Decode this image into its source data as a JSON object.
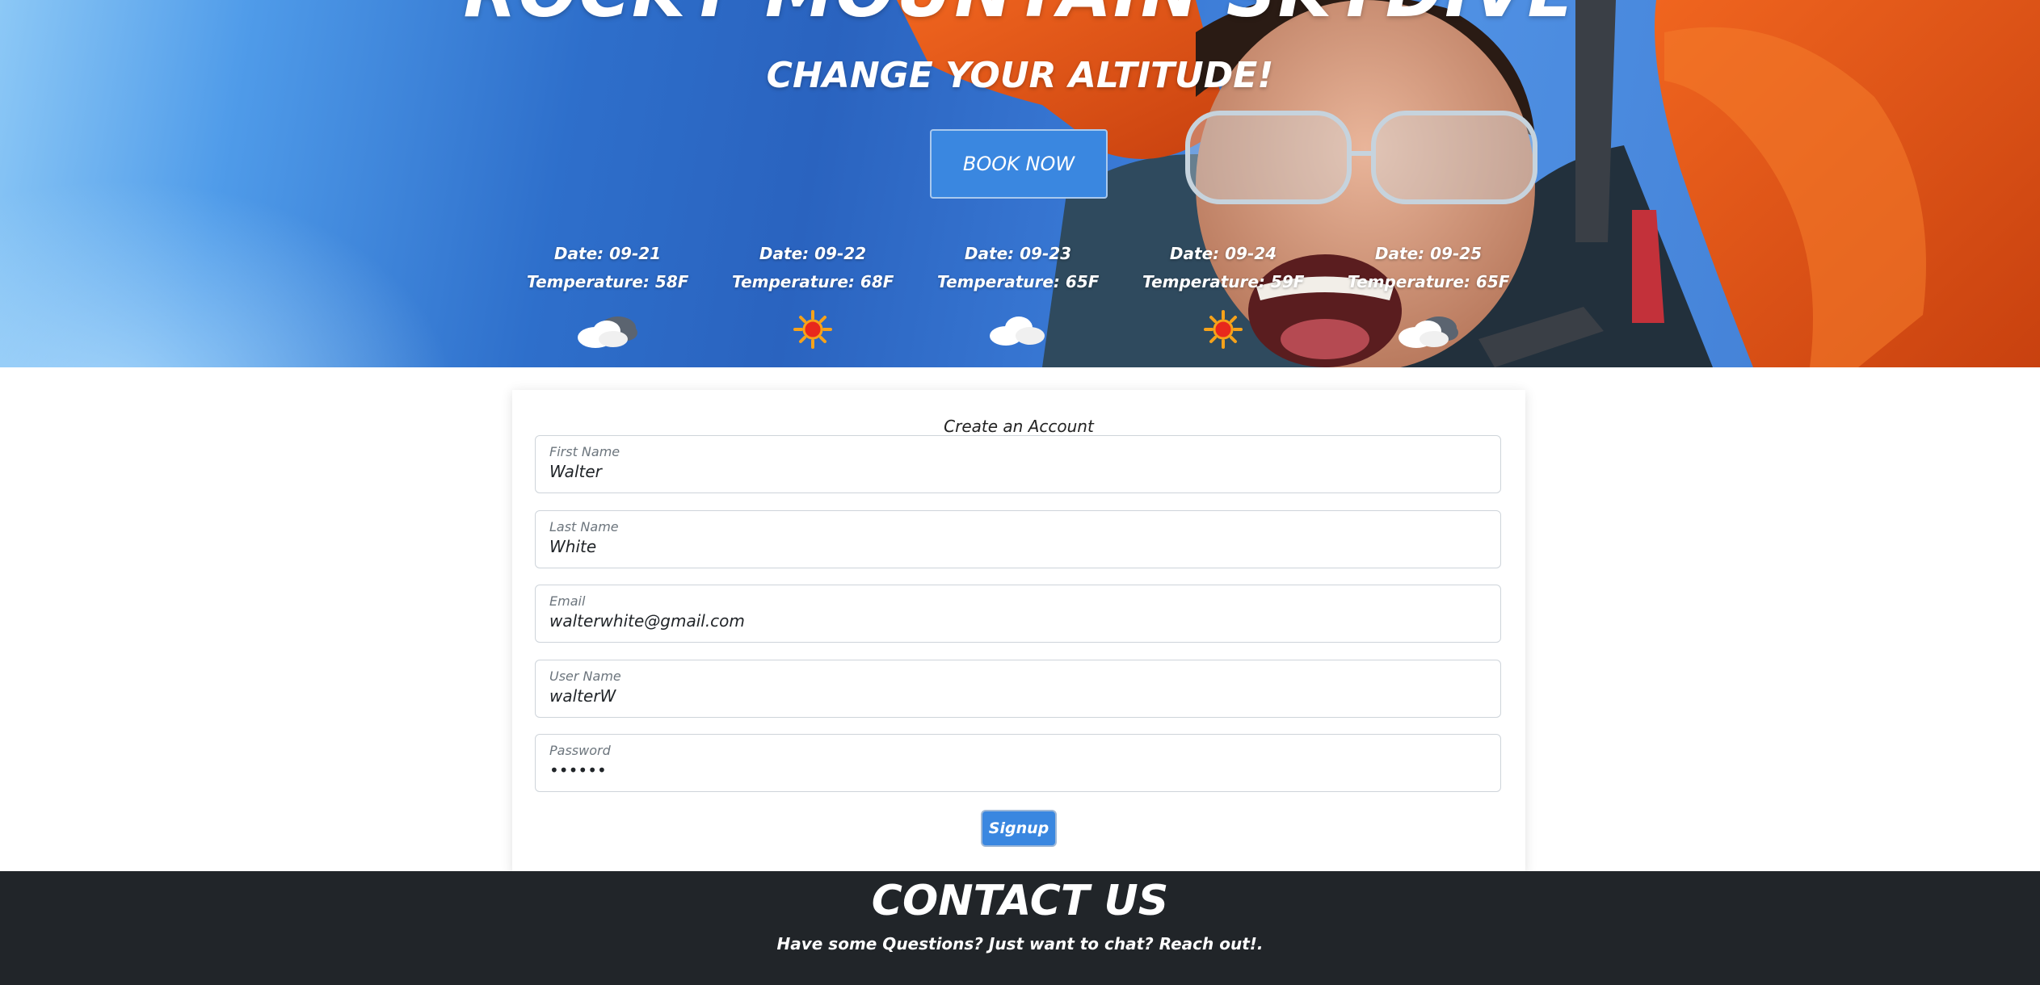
{
  "hero": {
    "title": "ROCKY MOUNTAIN SKYDIVE",
    "subtitle": "CHANGE YOUR ALTITUDE!",
    "book_button": "BOOK NOW"
  },
  "forecast": [
    {
      "date": "Date: 09-21",
      "temp": "Temperature: 58F",
      "icon": "partly-cloudy-icon"
    },
    {
      "date": "Date: 09-22",
      "temp": "Temperature: 68F",
      "icon": "sun-icon"
    },
    {
      "date": "Date: 09-23",
      "temp": "Temperature: 65F",
      "icon": "cloud-icon"
    },
    {
      "date": "Date: 09-24",
      "temp": "Temperature: 59F",
      "icon": "sun-icon"
    },
    {
      "date": "Date: 09-25",
      "temp": "Temperature: 65F",
      "icon": "partly-cloudy-icon"
    }
  ],
  "signup_form": {
    "title": "Create an Account",
    "fields": [
      {
        "label": "First Name",
        "value": "Walter"
      },
      {
        "label": "Last Name",
        "value": "White"
      },
      {
        "label": "Email",
        "value": "walterwhite@gmail.com"
      },
      {
        "label": "User Name",
        "value": "walterW"
      },
      {
        "label": "Password",
        "value": "••••••"
      }
    ],
    "submit": "Signup"
  },
  "contact": {
    "title": "CONTACT US",
    "subtitle": "Have some Questions? Just want to chat? Reach out!."
  },
  "colors": {
    "accent_button": "#3a87e0",
    "footer_bg": "#212529",
    "jacket": "#e8541a"
  }
}
